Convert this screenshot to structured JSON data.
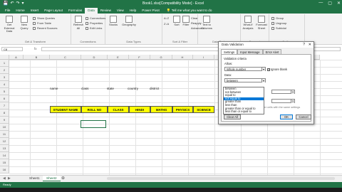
{
  "window": {
    "title": "Book1.xlsx[Compatibility Mode] - Excel",
    "controls": [
      "—",
      "▢",
      "✕"
    ]
  },
  "qat": [
    "💾",
    "↶",
    "↷",
    "▾"
  ],
  "tabs": [
    "File",
    "Home",
    "Insert",
    "Page Layout",
    "Formulas",
    "Data",
    "Review",
    "View",
    "Help",
    "Power Pivot"
  ],
  "active_tab": "Data",
  "tell_me": "Tell me what you want to do",
  "ribbon": {
    "groups": [
      "Get & Transform",
      "Connections",
      "Data Types",
      "Sort & Filter",
      "Data Tools",
      "Forecast",
      "Outline"
    ],
    "get_data": "Get External Data",
    "new_query": "New Query",
    "show_queries": "Show Queries",
    "from_table": "From Table",
    "recent_sources": "Recent Sources",
    "refresh_all": "Refresh All",
    "connections": "Connections",
    "properties": "Properties",
    "edit_links": "Edit Links",
    "stocks": "Stocks",
    "geography": "Geography",
    "sort_az": "A↓Z",
    "sort_za": "Z↓A",
    "sort": "Sort",
    "filter": "Filter",
    "clear": "Clear",
    "reapply": "Reapply",
    "advanced": "Advanced",
    "text_to_columns": "Text to Columns",
    "what_if": "What-If Analysis",
    "forecast_sheet": "Forecast Sheet",
    "group": "Group",
    "ungroup": "Ungroup",
    "subtotal": "Subtotal"
  },
  "formula_bar": {
    "name_box": "C8",
    "fx": "fx"
  },
  "columns": [
    "A",
    "B",
    "C",
    "D",
    "E",
    "F",
    "G",
    "H",
    "I",
    "J",
    "K",
    "L",
    "M"
  ],
  "rows": [
    "1",
    "2",
    "3",
    "4",
    "5",
    "6",
    "7",
    "8",
    "9",
    "10",
    "11",
    "12",
    "13",
    "14",
    "15",
    "16"
  ],
  "labels_row": [
    "name",
    "class",
    "state",
    "country",
    "district"
  ],
  "header_row": [
    "STUDENT NAME",
    "ROLL NO",
    "CLASS",
    "HINDI",
    "MATHS",
    "PHYSICS",
    "SCIENCE"
  ],
  "sheets": [
    "Sheet1",
    "Sheet2"
  ],
  "active_sheet": "Sheet2",
  "status": "Ready",
  "dialog": {
    "title": "Data Validation",
    "help": "?",
    "close": "✕",
    "tabs": [
      "Settings",
      "Input Message",
      "Error Alert"
    ],
    "criteria_heading": "Validation criteria",
    "allow_label": "Allow:",
    "allow_value": "Whole number",
    "ignore_blank": "Ignore blank",
    "data_label": "Data:",
    "data_value": "between",
    "options": [
      "between",
      "not between",
      "equal to",
      "not equal to",
      "greater than",
      "less than",
      "greater than or equal to",
      "less than or equal to"
    ],
    "highlighted_index": 3,
    "apply_text": "Apply these changes to all other cells with the same settings",
    "clear_all": "Clear All",
    "ok": "OK",
    "cancel": "Cancel"
  }
}
